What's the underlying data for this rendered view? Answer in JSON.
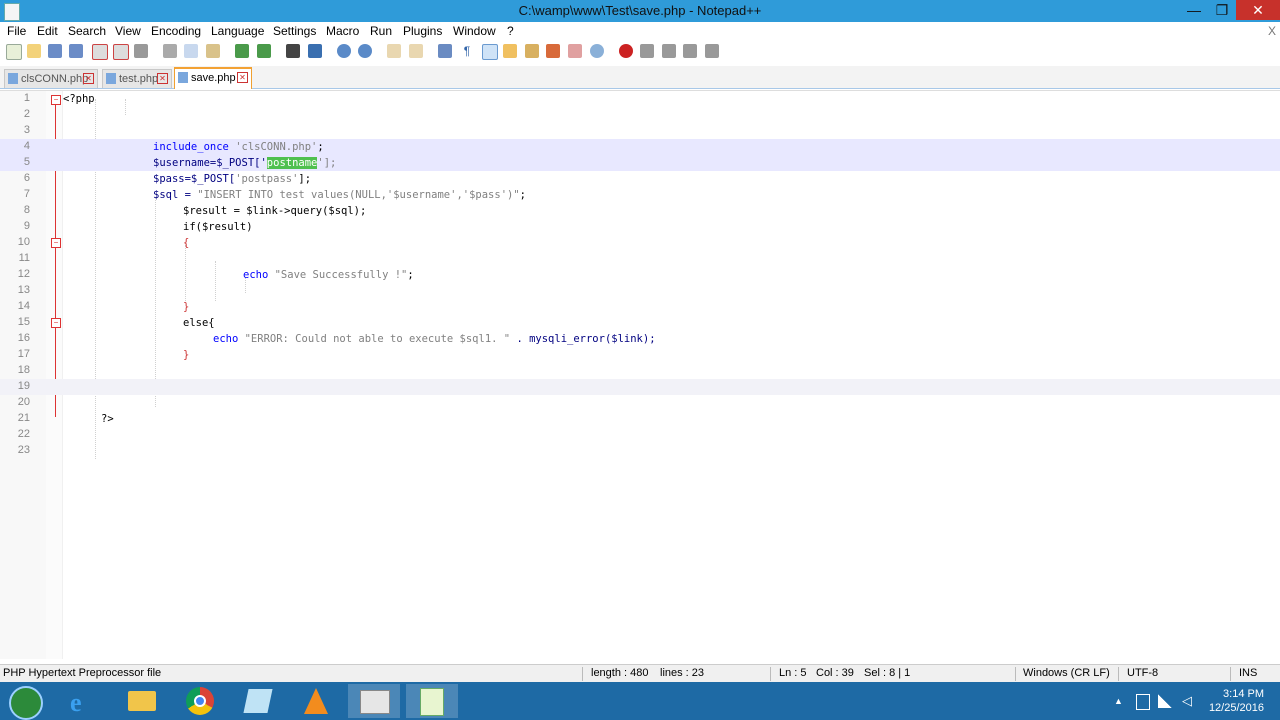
{
  "window": {
    "title": "C:\\wamp\\www\\Test\\save.php - Notepad++",
    "minimize": "—",
    "restore": "❐",
    "close": "✕"
  },
  "menu": [
    "File",
    "Edit",
    "Search",
    "View",
    "Encoding",
    "Language",
    "Settings",
    "Macro",
    "Run",
    "Plugins",
    "Window",
    "?"
  ],
  "menu_close": "X",
  "tabs": [
    {
      "label": "clsCONN.php",
      "active": false
    },
    {
      "label": "test.php",
      "active": false
    },
    {
      "label": "save.php",
      "active": true
    }
  ],
  "editor": {
    "line_numbers": [
      "1",
      "2",
      "3",
      "4",
      "5",
      "6",
      "7",
      "8",
      "9",
      "10",
      "11",
      "12",
      "13",
      "14",
      "15",
      "16",
      "17",
      "18",
      "19",
      "20",
      "21",
      "22",
      "23"
    ],
    "lines": {
      "l1": "<?php",
      "l4a": "include_once ",
      "l4b": "'clsCONN.php'",
      "l4c": ";",
      "l5a": "$username=$_POST['",
      "l5sel": "postname",
      "l5b": "'];",
      "l6a": "$pass=$_POST[",
      "l6b": "'postpass'",
      "l6c": "];",
      "l7a": "$sql = ",
      "l7b": "\"INSERT INTO test values(NULL,'$username','$pass')\"",
      "l7c": ";",
      "l8": "$result = $link->query($sql);",
      "l9": "if($result)",
      "l10": "{",
      "l12a": "echo ",
      "l12b": "\"Save Successfully !\"",
      "l12c": ";",
      "l14": "}",
      "l15": "else{",
      "l16a": "echo ",
      "l16b": "\"ERROR: Could not able to execute $sql1. \"",
      "l16c": " . mysqli_error($link);",
      "l17": "}",
      "l21": "?>"
    }
  },
  "status": {
    "file_type": "PHP Hypertext Preprocessor file",
    "length": "length : 480",
    "lines": "lines : 23",
    "ln": "Ln : 5",
    "col": "Col : 39",
    "sel": "Sel : 8 | 1",
    "eol": "Windows (CR LF)",
    "encoding": "UTF-8",
    "mode": "INS"
  },
  "taskbar": {
    "time": "3:14 PM",
    "date": "12/25/2016",
    "tray_arrow": "▲"
  },
  "colors": {
    "titlebar": "#2f9bd9",
    "taskbar": "#1e6aa5",
    "close": "#c7312b",
    "selection": "#4fc04f"
  }
}
